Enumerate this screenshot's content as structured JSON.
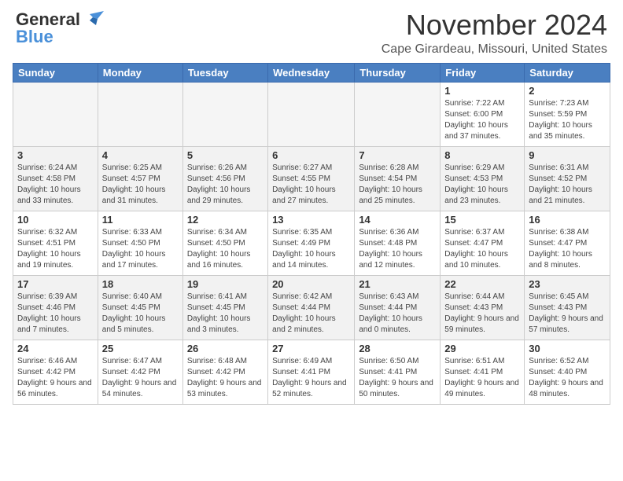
{
  "header": {
    "logo_line1": "General",
    "logo_line2": "Blue",
    "month_title": "November 2024",
    "location": "Cape Girardeau, Missouri, United States"
  },
  "weekdays": [
    "Sunday",
    "Monday",
    "Tuesday",
    "Wednesday",
    "Thursday",
    "Friday",
    "Saturday"
  ],
  "weeks": [
    [
      {
        "date": "",
        "info": ""
      },
      {
        "date": "",
        "info": ""
      },
      {
        "date": "",
        "info": ""
      },
      {
        "date": "",
        "info": ""
      },
      {
        "date": "",
        "info": ""
      },
      {
        "date": "1",
        "info": "Sunrise: 7:22 AM\nSunset: 6:00 PM\nDaylight: 10 hours and 37 minutes."
      },
      {
        "date": "2",
        "info": "Sunrise: 7:23 AM\nSunset: 5:59 PM\nDaylight: 10 hours and 35 minutes."
      }
    ],
    [
      {
        "date": "3",
        "info": "Sunrise: 6:24 AM\nSunset: 4:58 PM\nDaylight: 10 hours and 33 minutes."
      },
      {
        "date": "4",
        "info": "Sunrise: 6:25 AM\nSunset: 4:57 PM\nDaylight: 10 hours and 31 minutes."
      },
      {
        "date": "5",
        "info": "Sunrise: 6:26 AM\nSunset: 4:56 PM\nDaylight: 10 hours and 29 minutes."
      },
      {
        "date": "6",
        "info": "Sunrise: 6:27 AM\nSunset: 4:55 PM\nDaylight: 10 hours and 27 minutes."
      },
      {
        "date": "7",
        "info": "Sunrise: 6:28 AM\nSunset: 4:54 PM\nDaylight: 10 hours and 25 minutes."
      },
      {
        "date": "8",
        "info": "Sunrise: 6:29 AM\nSunset: 4:53 PM\nDaylight: 10 hours and 23 minutes."
      },
      {
        "date": "9",
        "info": "Sunrise: 6:31 AM\nSunset: 4:52 PM\nDaylight: 10 hours and 21 minutes."
      }
    ],
    [
      {
        "date": "10",
        "info": "Sunrise: 6:32 AM\nSunset: 4:51 PM\nDaylight: 10 hours and 19 minutes."
      },
      {
        "date": "11",
        "info": "Sunrise: 6:33 AM\nSunset: 4:50 PM\nDaylight: 10 hours and 17 minutes."
      },
      {
        "date": "12",
        "info": "Sunrise: 6:34 AM\nSunset: 4:50 PM\nDaylight: 10 hours and 16 minutes."
      },
      {
        "date": "13",
        "info": "Sunrise: 6:35 AM\nSunset: 4:49 PM\nDaylight: 10 hours and 14 minutes."
      },
      {
        "date": "14",
        "info": "Sunrise: 6:36 AM\nSunset: 4:48 PM\nDaylight: 10 hours and 12 minutes."
      },
      {
        "date": "15",
        "info": "Sunrise: 6:37 AM\nSunset: 4:47 PM\nDaylight: 10 hours and 10 minutes."
      },
      {
        "date": "16",
        "info": "Sunrise: 6:38 AM\nSunset: 4:47 PM\nDaylight: 10 hours and 8 minutes."
      }
    ],
    [
      {
        "date": "17",
        "info": "Sunrise: 6:39 AM\nSunset: 4:46 PM\nDaylight: 10 hours and 7 minutes."
      },
      {
        "date": "18",
        "info": "Sunrise: 6:40 AM\nSunset: 4:45 PM\nDaylight: 10 hours and 5 minutes."
      },
      {
        "date": "19",
        "info": "Sunrise: 6:41 AM\nSunset: 4:45 PM\nDaylight: 10 hours and 3 minutes."
      },
      {
        "date": "20",
        "info": "Sunrise: 6:42 AM\nSunset: 4:44 PM\nDaylight: 10 hours and 2 minutes."
      },
      {
        "date": "21",
        "info": "Sunrise: 6:43 AM\nSunset: 4:44 PM\nDaylight: 10 hours and 0 minutes."
      },
      {
        "date": "22",
        "info": "Sunrise: 6:44 AM\nSunset: 4:43 PM\nDaylight: 9 hours and 59 minutes."
      },
      {
        "date": "23",
        "info": "Sunrise: 6:45 AM\nSunset: 4:43 PM\nDaylight: 9 hours and 57 minutes."
      }
    ],
    [
      {
        "date": "24",
        "info": "Sunrise: 6:46 AM\nSunset: 4:42 PM\nDaylight: 9 hours and 56 minutes."
      },
      {
        "date": "25",
        "info": "Sunrise: 6:47 AM\nSunset: 4:42 PM\nDaylight: 9 hours and 54 minutes."
      },
      {
        "date": "26",
        "info": "Sunrise: 6:48 AM\nSunset: 4:42 PM\nDaylight: 9 hours and 53 minutes."
      },
      {
        "date": "27",
        "info": "Sunrise: 6:49 AM\nSunset: 4:41 PM\nDaylight: 9 hours and 52 minutes."
      },
      {
        "date": "28",
        "info": "Sunrise: 6:50 AM\nSunset: 4:41 PM\nDaylight: 9 hours and 50 minutes."
      },
      {
        "date": "29",
        "info": "Sunrise: 6:51 AM\nSunset: 4:41 PM\nDaylight: 9 hours and 49 minutes."
      },
      {
        "date": "30",
        "info": "Sunrise: 6:52 AM\nSunset: 4:40 PM\nDaylight: 9 hours and 48 minutes."
      }
    ]
  ]
}
